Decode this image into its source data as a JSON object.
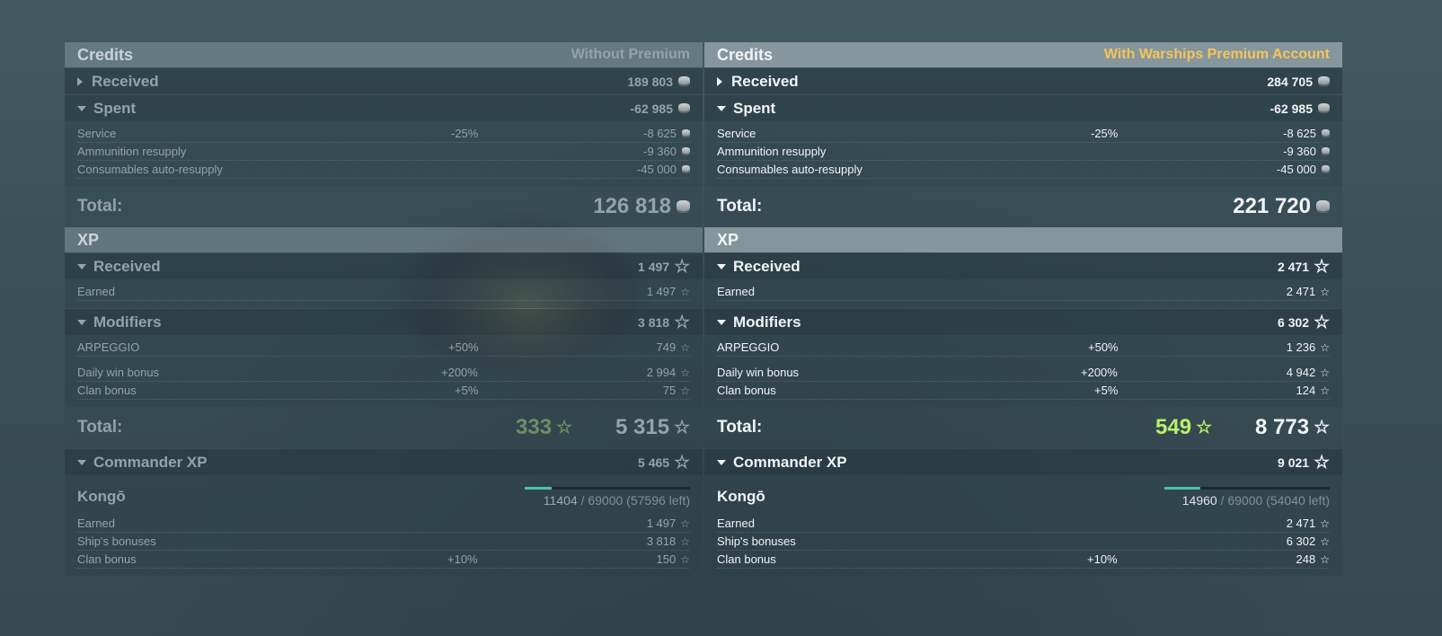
{
  "left": {
    "credits_title": "Credits",
    "account": "Without Premium",
    "received": {
      "label": "Received",
      "value": "189 803"
    },
    "spent": {
      "label": "Spent",
      "value": "-62 985"
    },
    "spent_items": [
      {
        "label": "Service",
        "pct": "-25%",
        "value": "-8 625"
      },
      {
        "label": "Ammunition resupply",
        "pct": "",
        "value": "-9 360"
      },
      {
        "label": "Consumables auto-resupply",
        "pct": "",
        "value": "-45 000"
      }
    ],
    "credits_total": {
      "label": "Total:",
      "value": "126 818"
    },
    "xp_title": "XP",
    "xp_received": {
      "label": "Received",
      "value": "1 497"
    },
    "xp_received_items": [
      {
        "label": "Earned",
        "pct": "",
        "value": "1 497"
      }
    ],
    "modifiers": {
      "label": "Modifiers",
      "value": "3 818"
    },
    "modifier_items": [
      {
        "label": "ARPEGGIO",
        "pct": "+50%",
        "value": "749"
      },
      {
        "label": "Daily win bonus",
        "pct": "+200%",
        "value": "2 994"
      },
      {
        "label": "Clan bonus",
        "pct": "+5%",
        "value": "75"
      }
    ],
    "xp_total": {
      "label": "Total:",
      "free_xp": "333",
      "value": "5 315"
    },
    "commander": {
      "label": "Commander XP",
      "value": "5 465"
    },
    "ship": {
      "name": "Kongō",
      "current": "11404",
      "rest": " / 69000 (57596 left)",
      "progress": 0.165
    },
    "commander_items": [
      {
        "label": "Earned",
        "pct": "",
        "value": "1 497"
      },
      {
        "label": "Ship's bonuses",
        "pct": "",
        "value": "3 818"
      },
      {
        "label": "Clan bonus",
        "pct": "+10%",
        "value": "150"
      }
    ]
  },
  "right": {
    "credits_title": "Credits",
    "account": "With Warships Premium Account",
    "received": {
      "label": "Received",
      "value": "284 705"
    },
    "spent": {
      "label": "Spent",
      "value": "-62 985"
    },
    "spent_items": [
      {
        "label": "Service",
        "pct": "-25%",
        "value": "-8 625"
      },
      {
        "label": "Ammunition resupply",
        "pct": "",
        "value": "-9 360"
      },
      {
        "label": "Consumables auto-resupply",
        "pct": "",
        "value": "-45 000"
      }
    ],
    "credits_total": {
      "label": "Total:",
      "value": "221 720"
    },
    "xp_title": "XP",
    "xp_received": {
      "label": "Received",
      "value": "2 471"
    },
    "xp_received_items": [
      {
        "label": "Earned",
        "pct": "",
        "value": "2 471"
      }
    ],
    "modifiers": {
      "label": "Modifiers",
      "value": "6 302"
    },
    "modifier_items": [
      {
        "label": "ARPEGGIO",
        "pct": "+50%",
        "value": "1 236"
      },
      {
        "label": "Daily win bonus",
        "pct": "+200%",
        "value": "4 942"
      },
      {
        "label": "Clan bonus",
        "pct": "+5%",
        "value": "124"
      }
    ],
    "xp_total": {
      "label": "Total:",
      "free_xp": "549",
      "value": "8 773"
    },
    "commander": {
      "label": "Commander XP",
      "value": "9 021"
    },
    "ship": {
      "name": "Kongō",
      "current": "14960",
      "rest": " / 69000 (54040 left)",
      "progress": 0.217
    },
    "commander_items": [
      {
        "label": "Earned",
        "pct": "",
        "value": "2 471"
      },
      {
        "label": "Ship's bonuses",
        "pct": "",
        "value": "6 302"
      },
      {
        "label": "Clan bonus",
        "pct": "+10%",
        "value": "248"
      }
    ]
  },
  "icons": {
    "credit": "credit-coin-icon",
    "xp": "xp-star-icon",
    "free_xp": "free-xp-star-icon"
  },
  "colors": {
    "premium_accent": "#f4c55a",
    "free_xp_premium": "#b9f06a",
    "progress_fill": "#4cc1b0"
  }
}
